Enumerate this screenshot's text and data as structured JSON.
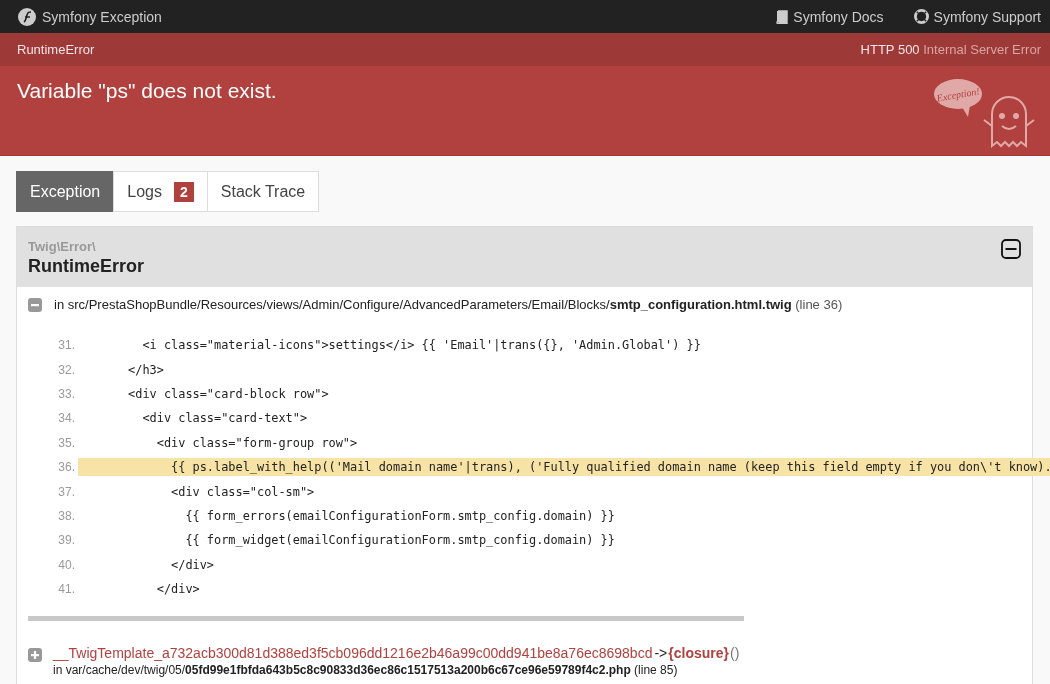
{
  "topbar": {
    "brand": "Symfony Exception",
    "links": [
      {
        "kind": "docs",
        "label": "Symfony Docs"
      },
      {
        "kind": "support",
        "label": "Symfony Support"
      }
    ]
  },
  "status": {
    "class": "RuntimeError",
    "code": "HTTP 500",
    "reason": "Internal Server Error"
  },
  "message": "Variable \"ps\" does not exist.",
  "mascot": {
    "bubble": "Exception!"
  },
  "tabs": [
    {
      "label": "Exception",
      "selected": true
    },
    {
      "label": "Logs",
      "badge": "2",
      "selected": false
    },
    {
      "label": "Stack Trace",
      "selected": false
    }
  ],
  "exception": {
    "namespace": "Twig\\Error\\",
    "class": "RuntimeError",
    "expanded": true,
    "trace": [
      {
        "expanded": true,
        "location": "in src/PrestaShopBundle/Resources/views/Admin/Configure/AdvancedParameters/Email/Blocks/**smtp_configuration.html.twig**",
        "line": "(line 36)",
        "code": [
          {
            "number": "31.",
            "text": "         <i class=\"material-icons\">settings</i> {{ 'Email'|trans({}, 'Admin.Global') }}",
            "selected": false
          },
          {
            "number": "32.",
            "text": "       </h3>",
            "selected": false
          },
          {
            "number": "33.",
            "text": "       <div class=\"card-block row\">",
            "selected": false
          },
          {
            "number": "34.",
            "text": "         <div class=\"card-text\">",
            "selected": false
          },
          {
            "number": "35.",
            "text": "           <div class=\"form-group row\">",
            "selected": false
          },
          {
            "number": "36.",
            "text": "             {{ ps.label_with_help(('Mail domain name'|trans), ('Fully qualified domain name (keep this field empty if you don\\'t know).",
            "selected": true
          },
          {
            "number": "37.",
            "text": "             <div class=\"col-sm\">",
            "selected": false
          },
          {
            "number": "38.",
            "text": "               {{ form_errors(emailConfigurationForm.smtp_config.domain) }}",
            "selected": false
          },
          {
            "number": "39.",
            "text": "               {{ form_widget(emailConfigurationForm.smtp_config.domain) }}",
            "selected": false
          },
          {
            "number": "40.",
            "text": "             </div>",
            "selected": false
          },
          {
            "number": "41.",
            "text": "           </div>",
            "selected": false
          }
        ]
      },
      {
        "expanded": false,
        "function_class": "__TwigTemplate_a732acb300d81d388ed3f5cb096dd1216e2b46a99c00dd941be8a76ec8698bcd",
        "arrow": "->",
        "function": "{closure}",
        "parens": "()",
        "location": "in var/cache/dev/twig/05/**05fd99e1fbfda643b5c8c90833d36ec86c1517513a200b6c67ce96e59789f4c2.php**",
        "line": "(line 85)"
      }
    ]
  }
}
